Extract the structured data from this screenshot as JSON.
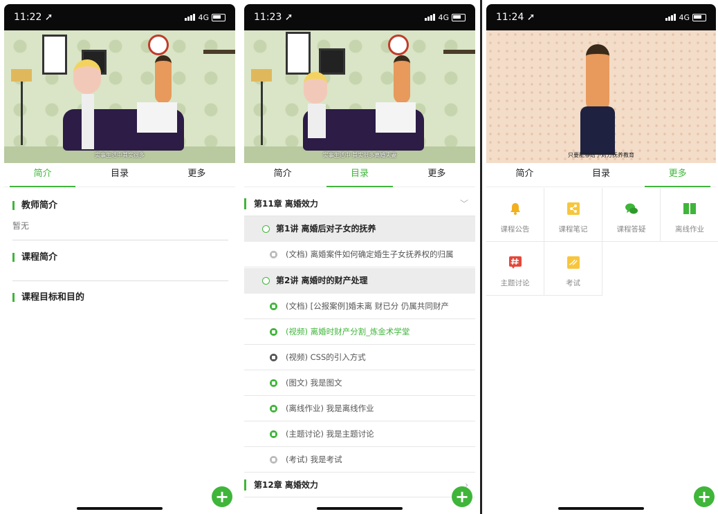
{
  "screens": [
    {
      "status": {
        "time": "11:22 ➚",
        "network": "4G"
      },
      "subtitle": "实事生活中其实很多",
      "tabs": [
        "简介",
        "目录",
        "更多"
      ],
      "active_tab": 0,
      "sections": [
        {
          "title": "教师简介",
          "text": "暂无"
        },
        {
          "title": "课程简介",
          "text": ""
        },
        {
          "title": "课程目标和目的",
          "text": ""
        }
      ],
      "fab": "+"
    },
    {
      "status": {
        "time": "11:23 ➚",
        "network": "4G"
      },
      "subtitle": "实事生活中 其实很多离婚夫妻",
      "tabs": [
        "简介",
        "目录",
        "更多"
      ],
      "active_tab": 1,
      "chapter1": {
        "title": "第11章 离婚效力",
        "chevron": "﹀"
      },
      "lecture1": "第1讲 离婚后对子女的抚养",
      "item1": "(文档) 离婚案件如何确定婚生子女抚养权的归属",
      "lecture2": "第2讲 离婚时的财产处理",
      "items": [
        "(文档) [公报案例]婚未离 财已分 仍属共同财产",
        "(视频) 离婚时财产分割_炼金术学堂",
        "(视频) CSS的引入方式",
        "(图文) 我是图文",
        "(离线作业) 我是离线作业",
        "(主题讨论) 我是主题讨论",
        "(考试) 我是考试"
      ],
      "chapter2": {
        "title": "第12章 离婚效力",
        "chevron": "›"
      },
      "fab": "+"
    },
    {
      "status": {
        "time": "11:24 ➚",
        "network": "4G"
      },
      "subtitle": "只要能够给予对方抚养教育",
      "tabs": [
        "简介",
        "目录",
        "更多"
      ],
      "active_tab": 2,
      "grid": [
        {
          "label": "课程公告",
          "icon": "bell-icon",
          "color": "#f2b01e"
        },
        {
          "label": "课程笔记",
          "icon": "note-share-icon",
          "color": "#f7c63d"
        },
        {
          "label": "课程答疑",
          "icon": "chat-bubbles-icon",
          "color": "#3fb53a"
        },
        {
          "label": "离线作业",
          "icon": "book-icon",
          "color": "#3fb53a"
        },
        {
          "label": "主题讨论",
          "icon": "hashtag-icon",
          "color": "#e5473a"
        },
        {
          "label": "考试",
          "icon": "exam-icon",
          "color": "#f7c63d"
        }
      ],
      "fab": "+"
    }
  ]
}
